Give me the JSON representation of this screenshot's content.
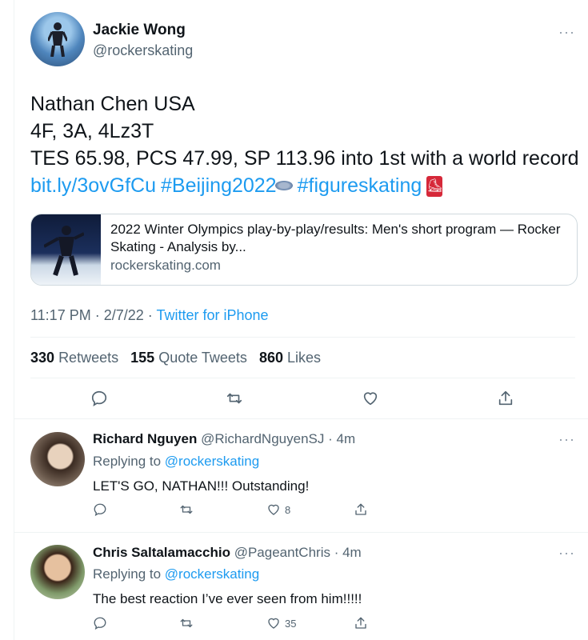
{
  "main_tweet": {
    "author_name": "Jackie Wong",
    "author_handle": "@rockerskating",
    "more_icon": "ellipsis-icon",
    "lines": [
      "Nathan Chen USA",
      "4F, 3A, 4Lz3T",
      "TES 65.98, PCS 47.99, SP 113.96 into 1st with a world record"
    ],
    "link": "bit.ly/3ovGfCu",
    "hashtag1": "#Beijing2022",
    "hashtag2": "#figureskating",
    "card": {
      "title": "2022 Winter Olympics play-by-play/results: Men's short program — Rocker Skating - Analysis by...",
      "domain": "rockerskating.com"
    },
    "time": "11:17 PM · 2/7/22",
    "source": "Twitter for iPhone",
    "retweets": "330",
    "retweets_label": "Retweets",
    "quotes": "155",
    "quotes_label": "Quote Tweets",
    "likes": "860",
    "likes_label": "Likes"
  },
  "replies": [
    {
      "name": "Richard Nguyen",
      "handle": "@RichardNguyenSJ",
      "age": "· 4m",
      "replying_prefix": "Replying to",
      "replying_to": "@rockerskating",
      "text": "LET'S GO, NATHAN!!! Outstanding!",
      "like_count": "8"
    },
    {
      "name": "Chris Saltalamacchio",
      "handle": "@PageantChris",
      "age": "· 4m",
      "replying_prefix": "Replying to",
      "replying_to": "@rockerskating",
      "text": "The best reaction I’ve ever seen from him!!!!!",
      "like_count": "35"
    }
  ],
  "colors": {
    "link": "#1d9bf0",
    "secondary": "#536471",
    "divider": "#eff3f4"
  }
}
